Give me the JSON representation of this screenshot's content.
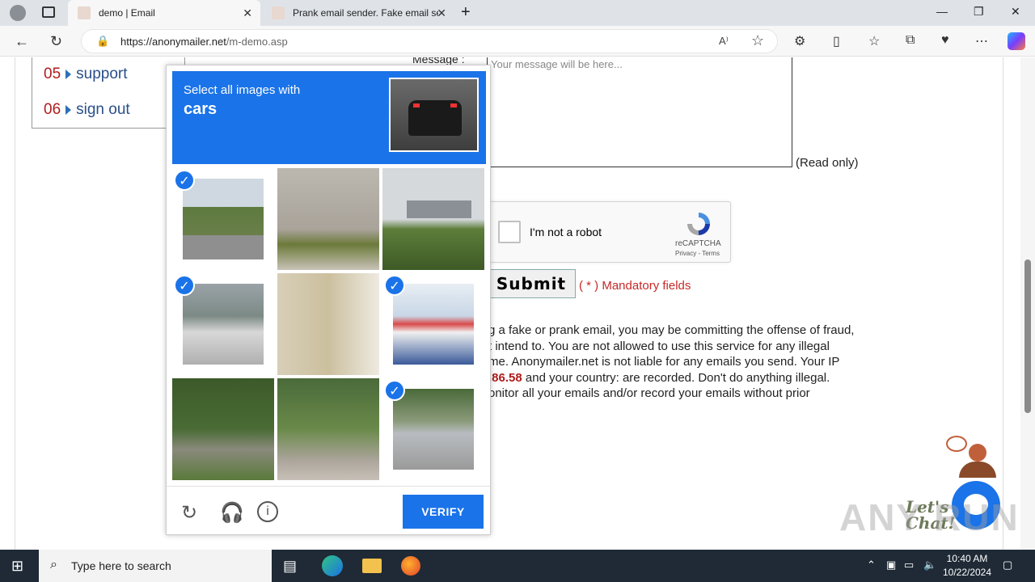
{
  "browser": {
    "tabs": [
      {
        "title": "demo | Email",
        "active": true
      },
      {
        "title": "Prank email sender. Fake email se",
        "active": false
      }
    ],
    "url_host": "https://anonymailer.net",
    "url_path": "/m-demo.asp"
  },
  "menu": {
    "items": [
      {
        "num": "05",
        "label": "support"
      },
      {
        "num": "06",
        "label": "sign out"
      }
    ]
  },
  "form": {
    "message_label": "Message :",
    "message_placeholder": "Your message will be here...",
    "readonly_note": "(Read only)",
    "recaptcha_label": "I'm not a robot",
    "recaptcha_brand": "reCAPTCHA",
    "recaptcha_terms": "Privacy - Terms",
    "submit_label": "Submit",
    "mandatory_note": "( * ) Mandatory fields"
  },
  "disclaimer": {
    "line1": "g a fake or prank email, you may be committing the offense of fraud,",
    "line2": "t intend to. You are not allowed to use this service for any illegal",
    "line3": "me. Anonymailer.net is not liable for any emails you send. Your IP",
    "ip_fragment": ".86.58",
    "line4_rest": " and your country: are recorded. Don't do anything illegal.",
    "line5": "onitor all your emails and/or record your emails without prior"
  },
  "captcha": {
    "instruction_small": "Select all images with",
    "instruction_big": "cars",
    "selected_tiles": [
      0,
      3,
      5,
      8
    ],
    "verify_label": "VERIFY",
    "footer_icons": [
      "reload-icon",
      "audio-icon",
      "info-icon"
    ]
  },
  "chat": {
    "label_line1": "Let's",
    "label_line2": "Chat!"
  },
  "watermark": "ANY RUN",
  "taskbar": {
    "search_placeholder": "Type here to search",
    "time": "10:40 AM",
    "date": "10/22/2024"
  },
  "colors": {
    "accent": "#1a73e8",
    "menu_link": "#2a4f8a",
    "menu_number": "#b01c1c",
    "mandatory": "#c62828"
  }
}
